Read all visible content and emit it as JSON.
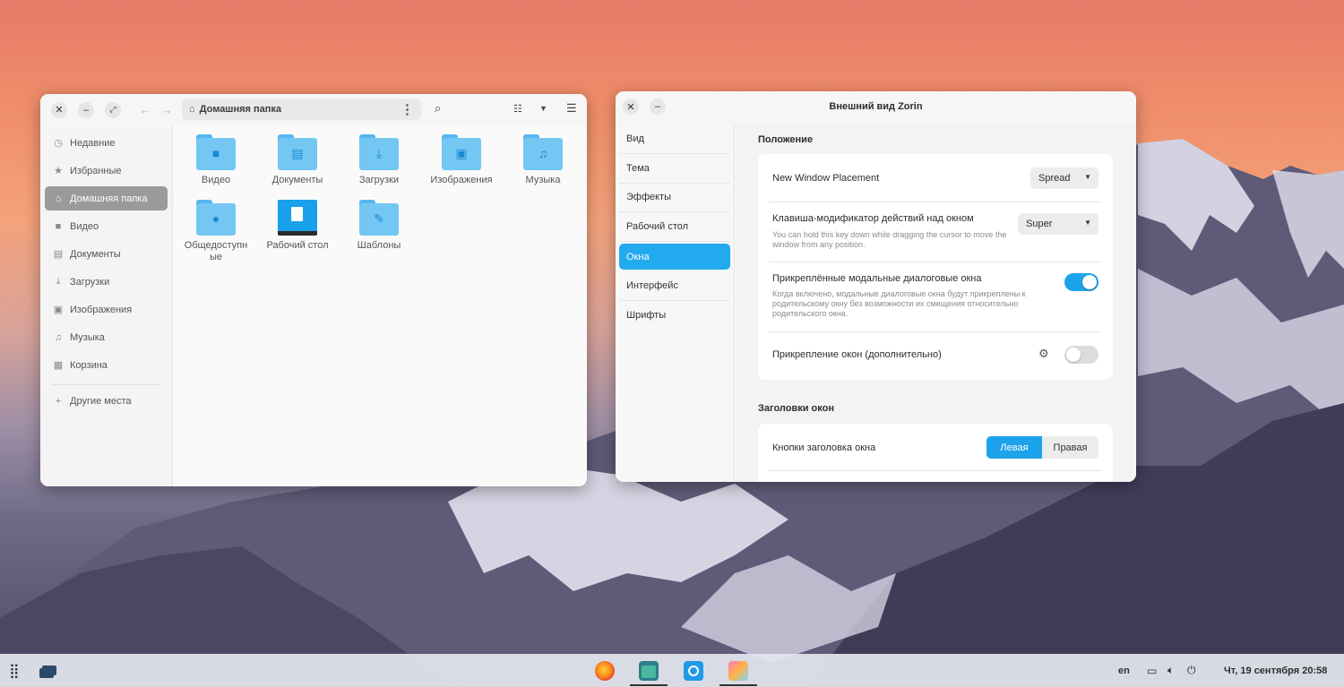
{
  "files": {
    "title": "Домашняя папка",
    "sidebar": [
      {
        "icon": "clock-icon",
        "glyph": "◷",
        "label": "Недавние"
      },
      {
        "icon": "star-icon",
        "glyph": "★",
        "label": "Избранные"
      },
      {
        "icon": "home-icon",
        "glyph": "⌂",
        "label": "Домашняя папка",
        "active": true
      },
      {
        "icon": "video-icon",
        "glyph": "■",
        "label": "Видео"
      },
      {
        "icon": "document-icon",
        "glyph": "▤",
        "label": "Документы"
      },
      {
        "icon": "download-icon",
        "glyph": "⤓",
        "label": "Загрузки"
      },
      {
        "icon": "image-icon",
        "glyph": "▣",
        "label": "Изображения"
      },
      {
        "icon": "music-icon",
        "glyph": "♫",
        "label": "Музыка"
      },
      {
        "icon": "trash-icon",
        "glyph": "▦",
        "label": "Корзина"
      }
    ],
    "other_places": "Другие места",
    "folders": [
      {
        "label": "Видео",
        "emblem": "■"
      },
      {
        "label": "Документы",
        "emblem": "▤"
      },
      {
        "label": "Загрузки",
        "emblem": "⤓"
      },
      {
        "label": "Изображения",
        "emblem": "▣"
      },
      {
        "label": "Музыка",
        "emblem": "♫"
      },
      {
        "label": "Общедоступные",
        "emblem": "●"
      },
      {
        "label": "Рабочий стол",
        "emblem": ""
      },
      {
        "label": "Шаблоны",
        "emblem": "✎"
      }
    ]
  },
  "tweaks": {
    "title": "Внешний вид Zorin",
    "nav": [
      "Вид",
      "Тема",
      "Эффекты",
      "Рабочий стол",
      "Окна",
      "Интерфейс",
      "Шрифты"
    ],
    "active_nav": "Окна",
    "section1": "Положение",
    "placement_label": "New Window Placement",
    "placement_value": "Spread",
    "modifier_label": "Клавиша-модификатор действий над окном",
    "modifier_desc": "You can hold this key down while dragging the cursor to move the window from any position.",
    "modifier_value": "Super",
    "attach_label": "Прикреплённые модальные диалоговые окна",
    "attach_desc": "Когда включено, модальные диалоговые окна будут прикреплены к родительскому окну без возможности их смещения относительно родительского окна.",
    "attach_on": true,
    "snap_label": "Прикрепление окон (дополнительно)",
    "snap_on": false,
    "section2": "Заголовки окон",
    "titlebar_label": "Кнопки заголовка окна",
    "left_label": "Левая",
    "right_label": "Правая"
  },
  "taskbar": {
    "lang": "en",
    "datetime": "Чт, 19 сентября 20:58",
    "apps": [
      "firefox-icon",
      "files-icon",
      "software-store-icon",
      "zorin-appearance-icon"
    ]
  },
  "colors": {
    "accent": "#1da3ec",
    "folder": "#74c7f3"
  }
}
